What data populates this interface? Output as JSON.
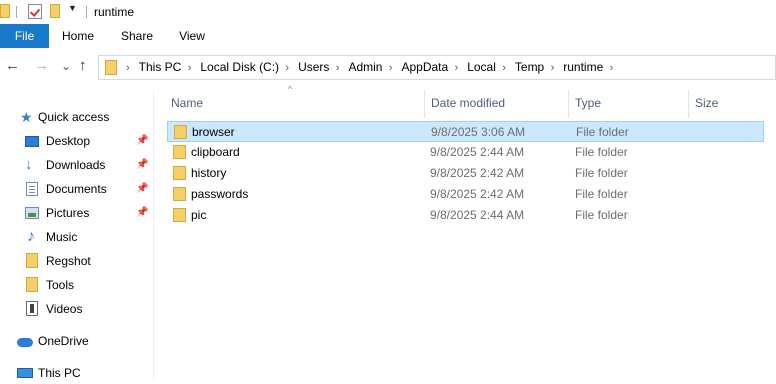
{
  "window": {
    "title": "runtime"
  },
  "quick_access_toolbar": {
    "icons": [
      "folder-icon",
      "properties-check-icon",
      "new-folder-icon",
      "customize-dropdown-icon"
    ]
  },
  "ribbon": {
    "tabs": [
      "File",
      "Home",
      "Share",
      "View"
    ]
  },
  "nav": {
    "back": "←",
    "forward": "→",
    "recent": "⌄",
    "up": "↑"
  },
  "address": {
    "crumbs": [
      "This PC",
      "Local Disk (C:)",
      "Users",
      "Admin",
      "AppData",
      "Local",
      "Temp",
      "runtime"
    ]
  },
  "sidebar": {
    "items": [
      {
        "label": "Quick access",
        "icon": "star-icon",
        "pinned": false
      },
      {
        "label": "Desktop",
        "icon": "desktop-icon",
        "pinned": true
      },
      {
        "label": "Downloads",
        "icon": "download-icon",
        "pinned": true
      },
      {
        "label": "Documents",
        "icon": "documents-icon",
        "pinned": true
      },
      {
        "label": "Pictures",
        "icon": "pictures-icon",
        "pinned": true
      },
      {
        "label": "Music",
        "icon": "music-icon",
        "pinned": false
      },
      {
        "label": "Regshot",
        "icon": "folder-icon",
        "pinned": false
      },
      {
        "label": "Tools",
        "icon": "folder-icon",
        "pinned": false
      },
      {
        "label": "Videos",
        "icon": "videos-icon",
        "pinned": false
      },
      {
        "label": "OneDrive",
        "icon": "cloud-icon",
        "pinned": false
      },
      {
        "label": "This PC",
        "icon": "pc-icon",
        "pinned": false
      }
    ]
  },
  "columns": {
    "name": "Name",
    "date": "Date modified",
    "type": "Type",
    "size": "Size"
  },
  "files": [
    {
      "name": "browser",
      "date": "9/8/2025 3:06 AM",
      "type": "File folder",
      "selected": true
    },
    {
      "name": "clipboard",
      "date": "9/8/2025 2:44 AM",
      "type": "File folder",
      "selected": false
    },
    {
      "name": "history",
      "date": "9/8/2025 2:42 AM",
      "type": "File folder",
      "selected": false
    },
    {
      "name": "passwords",
      "date": "9/8/2025 2:42 AM",
      "type": "File folder",
      "selected": false
    },
    {
      "name": "pic",
      "date": "9/8/2025 2:44 AM",
      "type": "File folder",
      "selected": false
    }
  ],
  "colors": {
    "accent": "#1979ca",
    "selection_bg": "#cce8ff",
    "selection_border": "#99d1ff",
    "folder": "#f5cf6a"
  }
}
